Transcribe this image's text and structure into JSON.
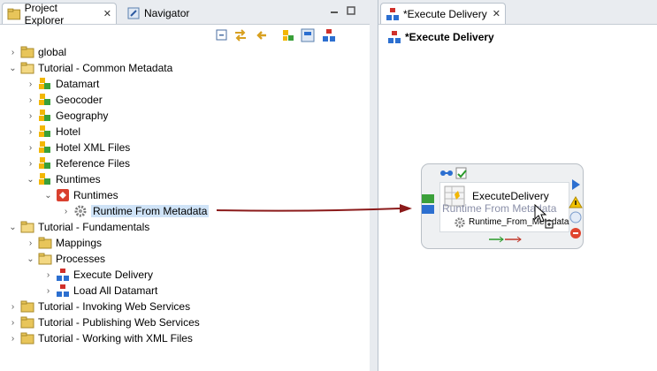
{
  "left_tabs": {
    "project_explorer": "Project Explorer",
    "navigator": "Navigator"
  },
  "tree": [
    {
      "label": "global"
    },
    {
      "label": "Tutorial - Common Metadata"
    },
    {
      "label": "Datamart"
    },
    {
      "label": "Geocoder"
    },
    {
      "label": "Geography"
    },
    {
      "label": "Hotel"
    },
    {
      "label": "Hotel XML Files"
    },
    {
      "label": "Reference Files"
    },
    {
      "label": "Runtimes"
    },
    {
      "label": "Runtimes"
    },
    {
      "label": "Runtime From Metadata"
    },
    {
      "label": "Tutorial - Fundamentals"
    },
    {
      "label": "Mappings"
    },
    {
      "label": "Processes"
    },
    {
      "label": "Execute Delivery"
    },
    {
      "label": "Load All Datamart"
    },
    {
      "label": "Tutorial - Invoking Web Services"
    },
    {
      "label": "Tutorial - Publishing Web Services"
    },
    {
      "label": "Tutorial - Working with XML Files"
    }
  ],
  "editor": {
    "tab_label": "*Execute Delivery",
    "title": "*Execute Delivery"
  },
  "node": {
    "name": "ExecuteDelivery",
    "drag_label": "Runtime From Metadata",
    "sub_label": "Runtime_From_Metadata"
  },
  "colors": {
    "selection": "#cfe3f7",
    "arrow": "#8b1a1a",
    "folder": "#e8c55a",
    "metadata": "#f2b705"
  }
}
